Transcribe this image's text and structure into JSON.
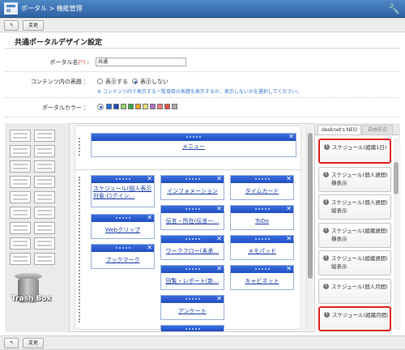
{
  "header": {
    "breadcrumb": "ポータル > 機能管理"
  },
  "toolbar": {
    "back_label": "↰",
    "change_label": "変更"
  },
  "page_title": "共通ポータルデザイン設定",
  "form": {
    "portal_name_label": "ポータル名",
    "required_mark": "(*)",
    "label_colon": ":",
    "portal_name_value": "共通",
    "content_title_label": "コンテンツ内の表題 ：",
    "show_label": "表示する",
    "hide_label": "表示しない",
    "content_title_selected": "hide",
    "note": "※ コンテンツ内で表示する一覧項目の表題を表示するか、表示しないかを選択してください。",
    "color_label": "ポータルカラー ：",
    "colors": [
      "#1f6fd8",
      "#1a4fb0",
      "#8fd06a",
      "#3aa84a",
      "#f3a12a",
      "#e5e07a",
      "#b070c8",
      "#ee7a7a",
      "#e84a3a",
      "#aaaaaa"
    ],
    "selected_color_index": 0
  },
  "trash": {
    "label": "Trash Box"
  },
  "widgets": {
    "menu": "メニュー",
    "schedule": "スケジュール(個人表示対象:ログイン…",
    "info": "インフォメーション",
    "timecard": "タイムカード",
    "web_clip": "Webクリップ",
    "whereabouts": "伝言・所在(伝言一…",
    "todo": "ToDo",
    "bookmark": "ブックマーク",
    "workflow": "ワークフロー(未承…",
    "memo": "メモパッド",
    "report": "回覧・レポート(新…",
    "cabinet": "キャビネット",
    "survey": "アンケート"
  },
  "right_panel": {
    "tab_active": "desknet's NEO",
    "tab_inactive": "自由形式",
    "items": [
      {
        "text": "スケジュール(組織1日)",
        "highlighted": true
      },
      {
        "text": "スケジュール(個人週間) 横表示",
        "highlighted": false
      },
      {
        "text": "スケジュール(個人週間) 縦表示",
        "highlighted": false
      },
      {
        "text": "スケジュール(組織週間) 横表示",
        "highlighted": false
      },
      {
        "text": "スケジュール(組織週間) 縦表示",
        "highlighted": false
      },
      {
        "text": "スケジュール(個人月間)",
        "highlighted": false
      },
      {
        "text": "スケジュール(組織月間)",
        "highlighted": true
      }
    ]
  },
  "colors": {
    "header": "#2f62a4",
    "widget_head": "#1f4fc2",
    "highlight": "#e02020",
    "link": "#1a3ea8"
  }
}
